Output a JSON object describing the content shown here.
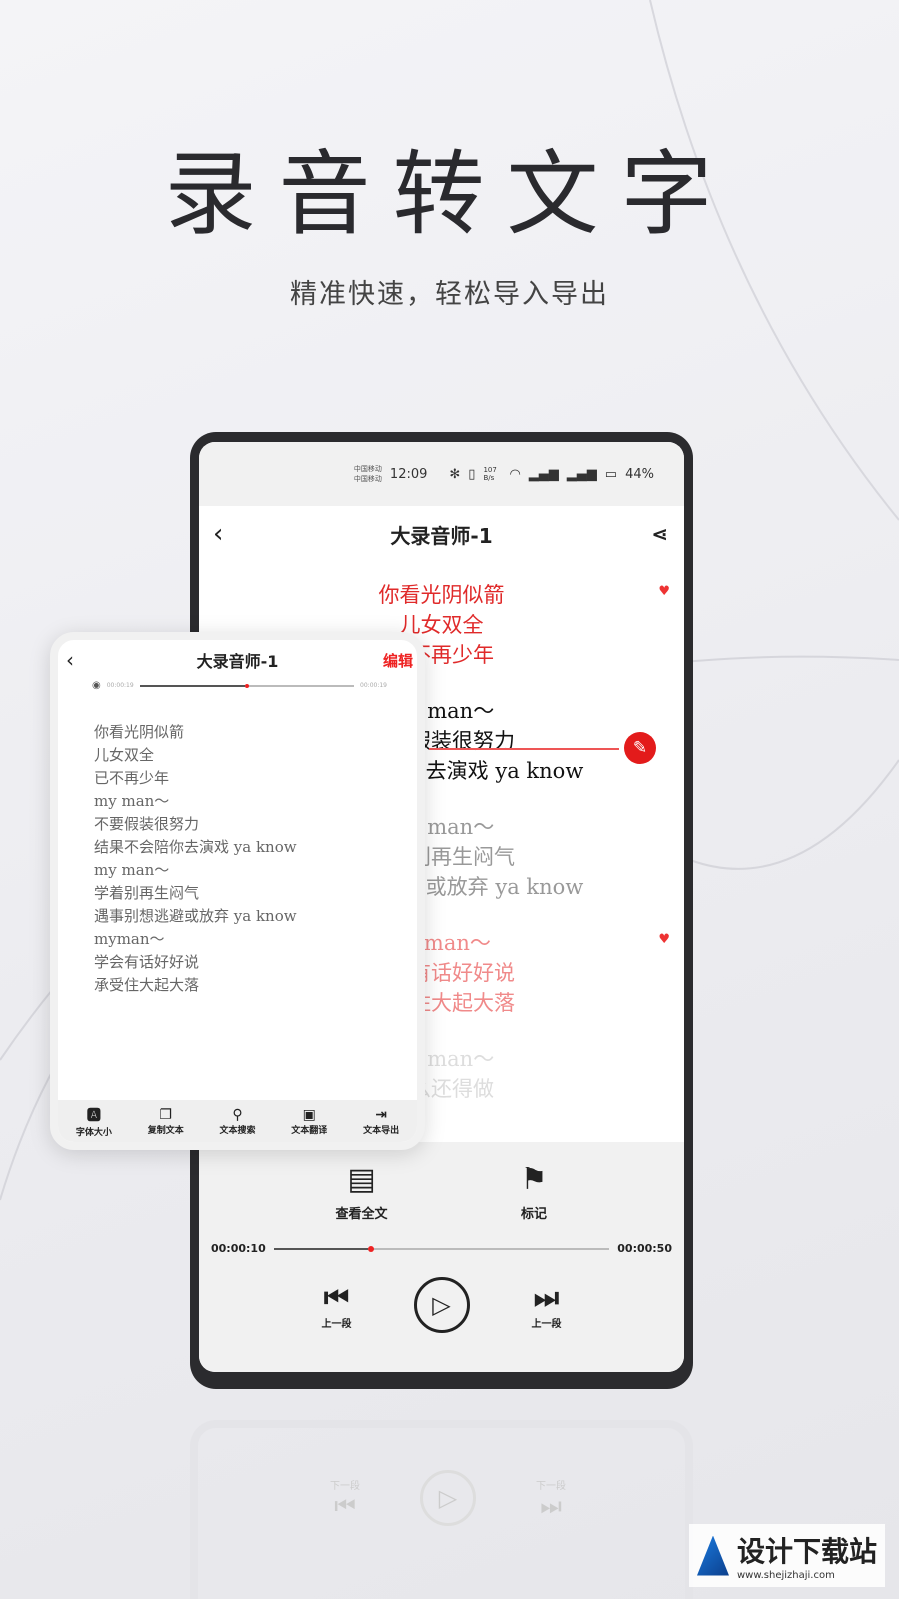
{
  "hero": {
    "title": "录音转文字",
    "subtitle": "精准快速，轻松导入导出"
  },
  "status": {
    "carrier1": "中国移动",
    "carrier2": "中国移动",
    "time": "12:09",
    "speed": "107 B/s",
    "battery": "44%"
  },
  "main": {
    "title": "大录音师-1",
    "groups": [
      {
        "lines": [
          "你看光阴似箭",
          "儿女双全",
          "已不再少年"
        ],
        "color": "#e02a2a",
        "marked": true
      },
      {
        "lines": [
          "my man～",
          "不要假装很努力",
          "结果不会陪你去演戏 ya know"
        ],
        "color": "#111111",
        "marked": false
      },
      {
        "lines": [
          "my man～",
          "学着别再生闷气",
          "遇事别想逃避或放弃 ya know"
        ],
        "color": "#999999",
        "marked": false
      },
      {
        "lines": [
          "myman～",
          "学会有话好好说",
          "承受住大起大落"
        ],
        "color": "#f08a8a",
        "marked": true
      },
      {
        "lines": [
          "my man～",
          "什么还得做"
        ],
        "color": "#dddddd",
        "marked": false
      }
    ],
    "actions": {
      "fulltext": "查看全文",
      "mark": "标记"
    },
    "player": {
      "current": "00:00:10",
      "total": "00:00:50",
      "progress": 0.28,
      "prev": "上一段",
      "next": "上一段"
    }
  },
  "card": {
    "title": "大录音师-1",
    "edit": "编辑",
    "current": "00:00:19",
    "total": "00:00:19",
    "progress": 0.49,
    "lines": [
      "你看光阴似箭",
      "儿女双全",
      "已不再少年",
      "my man～",
      "不要假装很努力",
      "结果不会陪你去演戏 ya know",
      "my man～",
      "学着别再生闷气",
      "遇事别想逃避或放弃 ya know",
      "myman～",
      "学会有话好好说",
      "承受住大起大落"
    ],
    "tools": [
      "字体大小",
      "复制文本",
      "文本搜索",
      "文本翻译",
      "文本导出"
    ]
  },
  "reflection": {
    "prev": "下一段",
    "next": "下一段"
  },
  "watermark": {
    "name": "设计下载站",
    "url": "www.shejizhaji.com"
  },
  "colors": {
    "accent": "#e31b1b"
  }
}
